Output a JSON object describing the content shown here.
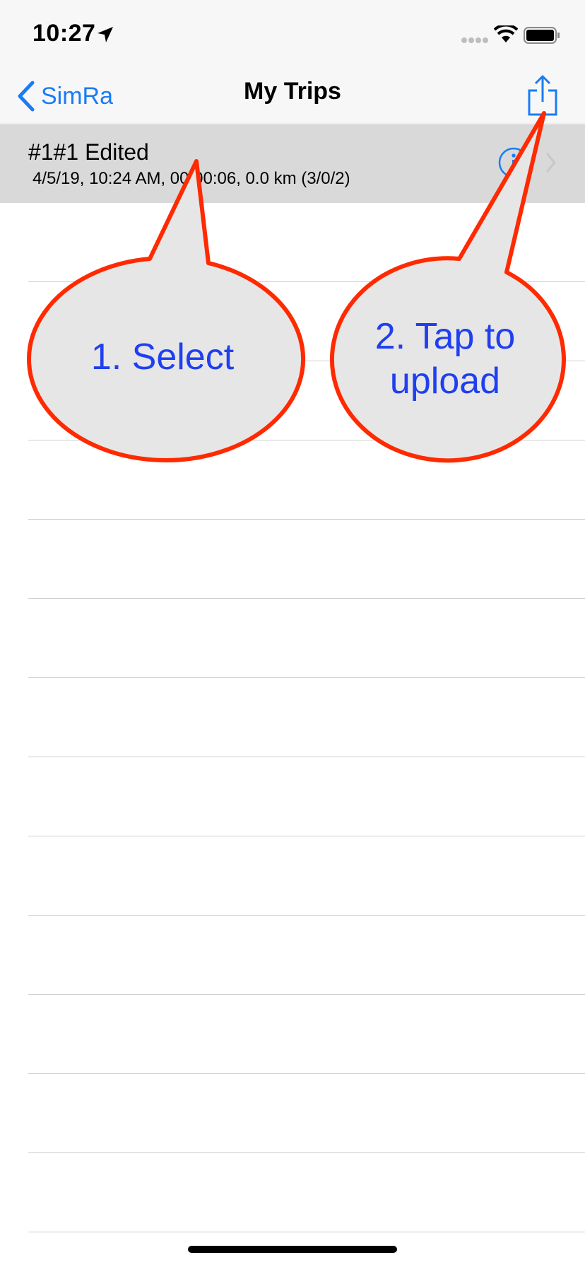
{
  "status_bar": {
    "time": "10:27",
    "icons": [
      "location-arrow-icon",
      "cellular-signal-icon",
      "wifi-icon",
      "battery-icon"
    ]
  },
  "nav": {
    "back_label": "SimRa",
    "title": "My Trips",
    "share_icon": "share-icon"
  },
  "trips": [
    {
      "title": "#1#1 Edited",
      "subtitle": "4/5/19, 10:24 AM, 00:00:06, 0.0 km (3/0/2)"
    }
  ],
  "callouts": {
    "select": "1. Select",
    "upload_line1": "2. Tap to",
    "upload_line2": "upload"
  },
  "colors": {
    "accent": "#1a7cf5",
    "selected_row": "#d9d9d9",
    "callout_stroke": "#ff2a00",
    "callout_fill": "#e6e6e6",
    "callout_text": "#1f3ff0"
  }
}
